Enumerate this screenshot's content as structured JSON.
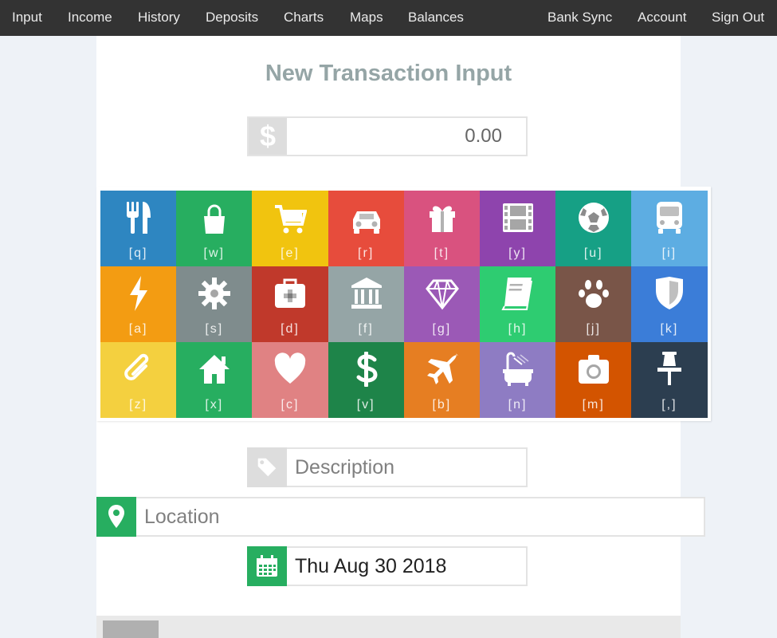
{
  "nav": {
    "left": [
      "Input",
      "Income",
      "History",
      "Deposits",
      "Charts",
      "Maps",
      "Balances"
    ],
    "right": [
      "Bank Sync",
      "Account",
      "Sign Out"
    ]
  },
  "page": {
    "title": "New Transaction Input"
  },
  "amount": {
    "currency_symbol": "$",
    "value": "0.00"
  },
  "categories": [
    {
      "key": "[q]",
      "icon": "utensils-icon",
      "color": "#2e86c1"
    },
    {
      "key": "[w]",
      "icon": "shopping-bag-icon",
      "color": "#27ae60"
    },
    {
      "key": "[e]",
      "icon": "cart-icon",
      "color": "#f1c40f"
    },
    {
      "key": "[r]",
      "icon": "car-icon",
      "color": "#e74c3c"
    },
    {
      "key": "[t]",
      "icon": "gift-icon",
      "color": "#d9527f"
    },
    {
      "key": "[y]",
      "icon": "film-icon",
      "color": "#8e44ad"
    },
    {
      "key": "[u]",
      "icon": "soccer-ball-icon",
      "color": "#16a085"
    },
    {
      "key": "[i]",
      "icon": "bus-icon",
      "color": "#5dade2"
    },
    {
      "key": "[a]",
      "icon": "bolt-icon",
      "color": "#f39c12"
    },
    {
      "key": "[s]",
      "icon": "gear-icon",
      "color": "#7f8c8d"
    },
    {
      "key": "[d]",
      "icon": "medkit-icon",
      "color": "#c0392b"
    },
    {
      "key": "[f]",
      "icon": "bank-icon",
      "color": "#95a5a6"
    },
    {
      "key": "[g]",
      "icon": "diamond-icon",
      "color": "#9b59b6"
    },
    {
      "key": "[h]",
      "icon": "book-icon",
      "color": "#2ecc71"
    },
    {
      "key": "[j]",
      "icon": "paw-icon",
      "color": "#795548"
    },
    {
      "key": "[k]",
      "icon": "shield-icon",
      "color": "#3b7dd8"
    },
    {
      "key": "[z]",
      "icon": "paperclip-icon",
      "color": "#f4d03f"
    },
    {
      "key": "[x]",
      "icon": "home-icon",
      "color": "#27ae60"
    },
    {
      "key": "[c]",
      "icon": "heart-icon",
      "color": "#e08283"
    },
    {
      "key": "[v]",
      "icon": "dollar-icon",
      "color": "#1e8449"
    },
    {
      "key": "[b]",
      "icon": "plane-icon",
      "color": "#e67e22"
    },
    {
      "key": "[n]",
      "icon": "bath-icon",
      "color": "#8e7cc3"
    },
    {
      "key": "[m]",
      "icon": "camera-icon",
      "color": "#d35400"
    },
    {
      "key": "[,]",
      "icon": "pin-icon",
      "color": "#2c3e50"
    }
  ],
  "description": {
    "placeholder": "Description",
    "value": ""
  },
  "location": {
    "placeholder": "Location",
    "value": ""
  },
  "date": {
    "value": "Thu Aug 30 2018"
  },
  "colors": {
    "navbar": "#333333",
    "title": "#95a5a6",
    "addon_gray": "#dddddd",
    "location_green": "#27ae60",
    "date_green": "#27ae60"
  }
}
